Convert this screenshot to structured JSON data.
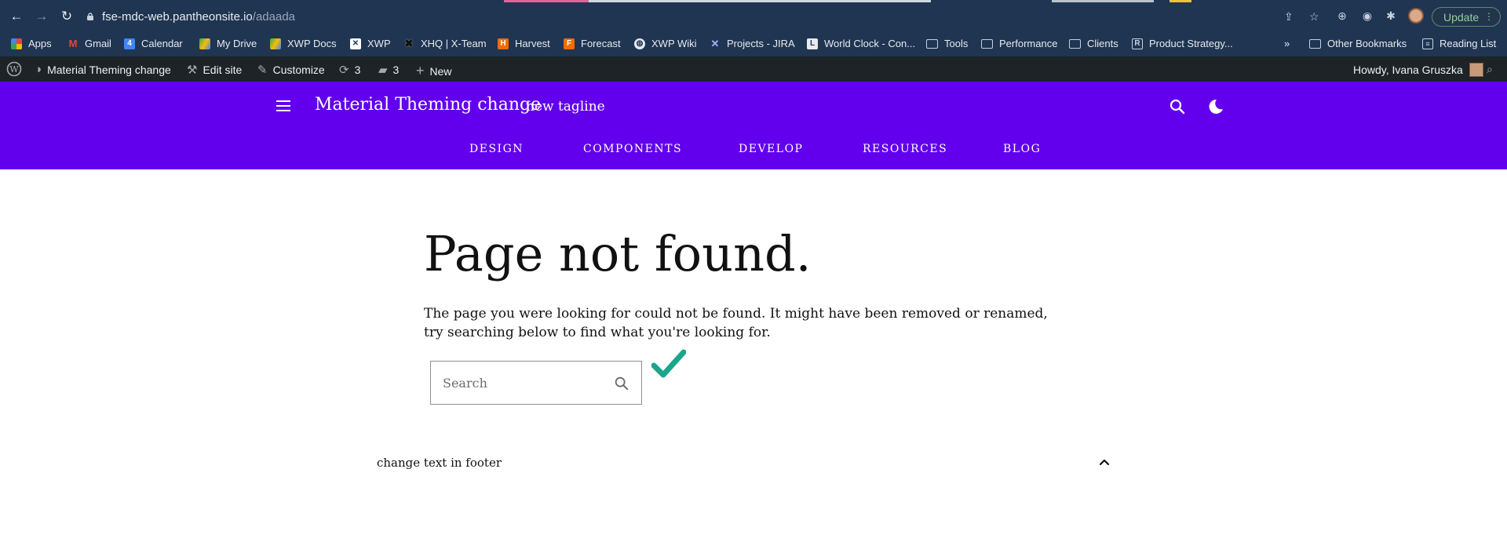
{
  "browser": {
    "url_host": "fse-mdc-web.pantheonsite.io",
    "url_path": "/adaada",
    "update_label": "Update"
  },
  "bookmarks": {
    "items": [
      {
        "label": "Apps"
      },
      {
        "label": "Gmail"
      },
      {
        "label": "Calendar"
      },
      {
        "label": "My Drive"
      },
      {
        "label": "XWP Docs"
      },
      {
        "label": "XWP"
      },
      {
        "label": "XHQ | X-Team"
      },
      {
        "label": "Harvest"
      },
      {
        "label": "Forecast"
      },
      {
        "label": "XWP Wiki"
      },
      {
        "label": "Projects - JIRA"
      },
      {
        "label": "World Clock - Con..."
      },
      {
        "label": "Tools"
      },
      {
        "label": "Performance"
      },
      {
        "label": "Clients"
      },
      {
        "label": "Product Strategy..."
      }
    ],
    "overflow": "»",
    "other": "Other Bookmarks",
    "reading_list": "Reading List"
  },
  "adminbar": {
    "site_name": "Material Theming change",
    "edit_site": "Edit site",
    "customize": "Customize",
    "updates_count": "3",
    "comments_count": "3",
    "new_label": "New",
    "howdy": "Howdy, Ivana Gruszka"
  },
  "header": {
    "title": "Material Theming change",
    "tagline": "new tagline",
    "nav": [
      "DESIGN",
      "COMPONENTS",
      "DEVELOP",
      "RESOURCES",
      "BLOG"
    ]
  },
  "main": {
    "title": "Page not found.",
    "message": "The page you were looking for could not be found. It might have been removed or renamed, try searching below to find what you're looking for.",
    "search_placeholder": "Search"
  },
  "footer": {
    "text": "change text in footer"
  },
  "colors": {
    "header_bg": "#6200ee",
    "adminbar_bg": "#1d2327",
    "browser_bg": "#1f3552",
    "check_color": "#1aa58c"
  }
}
